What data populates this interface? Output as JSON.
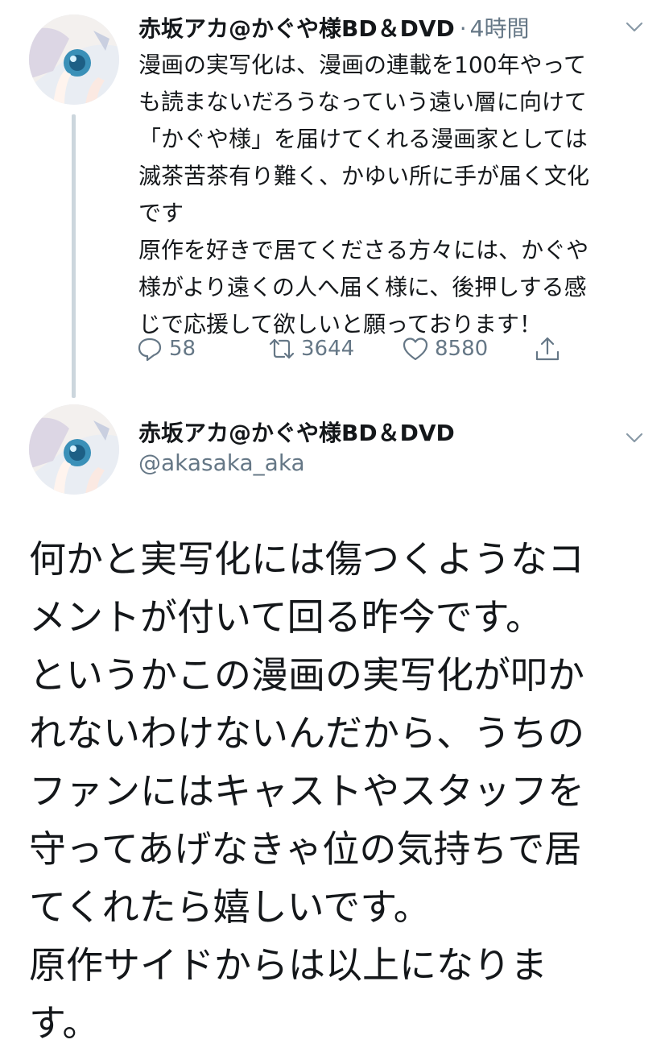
{
  "tweet1": {
    "author_name": "赤坂アカ@かぐや様BD＆DVD",
    "separator": "·",
    "time": "4時間",
    "text": "漫画の実写化は、漫画の連載を100年やって\nも読まないだろうなっていう遠い層に向けて\n「かぐや様」を届けてくれる漫画家としては\n滅茶苦茶有り難く、かゆい所に手が届く文化\nです\n原作を好きで居てくださる方々には、かぐや\n様がより遠くの人へ届く様に、後押しする感\nじで応援して欲しいと願っております！",
    "actions": {
      "reply_count": "58",
      "retweet_count": "3644",
      "like_count": "8580"
    }
  },
  "tweet2": {
    "author_name": "赤坂アカ@かぐや様BD＆DVD",
    "handle": "@akasaka_aka",
    "text": "何かと実写化には傷つくようなコ\nメントが付いて回る昨今です。\nというかこの漫画の実写化が叩か\nれないわけないんだから、うちの\nファンにはキャストやスタッフを\n守ってあげなきゃ位の気持ちで居\nてくれたら嬉しいです。\n原作サイドからは以上になりま\nす。"
  },
  "icons": {
    "reply": "reply-icon",
    "retweet": "retweet-icon",
    "like": "heart-icon",
    "share": "share-icon",
    "caret": "chevron-down-icon"
  },
  "colors": {
    "text": "#14171a",
    "secondary": "#657786",
    "thread_line": "#ccd6dd"
  }
}
